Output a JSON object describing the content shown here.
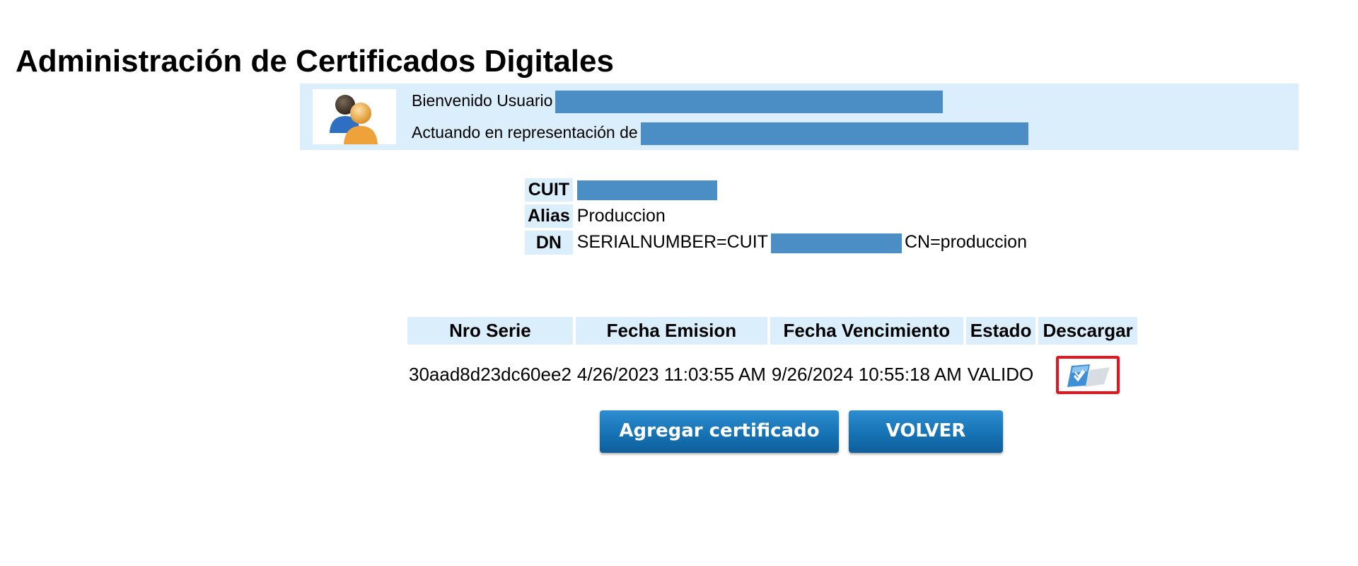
{
  "page": {
    "title": "Administración de Certificados Digitales"
  },
  "welcome": {
    "user_label": "Bienvenido Usuario",
    "rep_label": "Actuando en representación de"
  },
  "info": {
    "cuit_label": "CUIT",
    "alias_label": "Alias",
    "alias_value": "Produccion",
    "dn_label": "DN",
    "dn_prefix": "SERIALNUMBER=CUIT",
    "dn_suffix": "CN=produccion"
  },
  "certificates": {
    "headers": [
      "Nro Serie",
      "Fecha Emision",
      "Fecha Vencimiento",
      "Estado",
      "Descargar"
    ],
    "rows": [
      {
        "serial": "30aad8d23dc60ee2",
        "issued": "4/26/2023 11:03:55 AM",
        "expires": "9/26/2024 10:55:18 AM",
        "status": "VALIDO",
        "download_icon": "certificate-download-icon"
      }
    ]
  },
  "buttons": {
    "add": "Agregar certificado",
    "back": "VOLVER"
  },
  "colors": {
    "panel_bg": "#dbeefc",
    "redaction": "#4a8ec5",
    "button": "#1673b5",
    "highlight": "#e8141c"
  }
}
